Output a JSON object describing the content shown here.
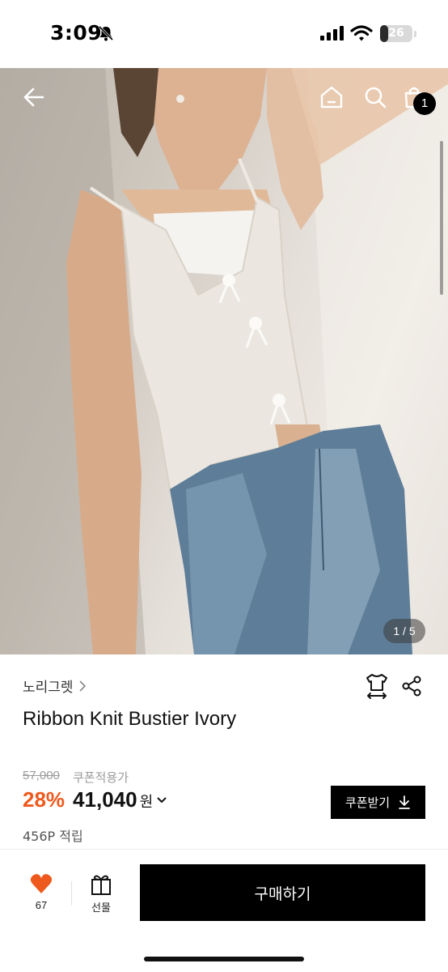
{
  "status_bar": {
    "time": "3:09",
    "battery_percent": "26",
    "battery_level": 0.26,
    "icons": [
      "bell-slash-icon",
      "cellular-signal-icon",
      "wifi-icon",
      "battery-icon"
    ]
  },
  "top_nav": {
    "icons": [
      "back-arrow-icon",
      "home-icon",
      "search-icon",
      "shopping-bag-icon"
    ],
    "cart_count": "1"
  },
  "gallery": {
    "pager": "1 / 5"
  },
  "product": {
    "brand": "노리그렛",
    "title": "Ribbon Knit Bustier Ivory",
    "original_price": "57,000",
    "coupon_note": "쿠폰적용가",
    "discount": "28%",
    "price": "41,040",
    "currency": "원",
    "points": "456P 적립"
  },
  "actions": {
    "coupon_button": "쿠폰받기",
    "like_count": "67",
    "gift_label": "선물",
    "buy_button": "구매하기"
  },
  "colors": {
    "accent": "#ee5a1e",
    "primary_button": "#000000"
  }
}
